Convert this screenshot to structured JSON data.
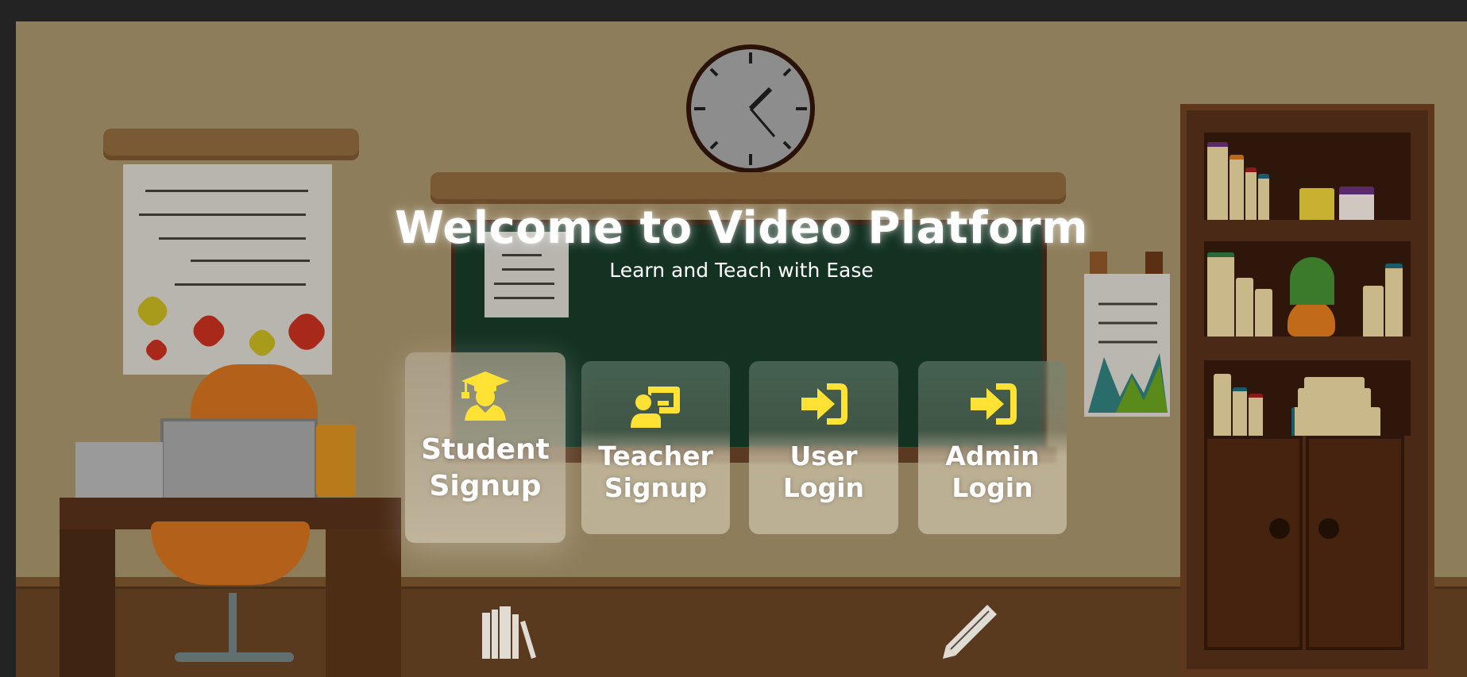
{
  "hero": {
    "title": "Welcome to Video Platform",
    "subtitle": "Learn and Teach with Ease"
  },
  "actions": [
    {
      "label": "Student\nSignup",
      "icon": "graduate-icon"
    },
    {
      "label": "Teacher\nSignup",
      "icon": "teacher-board-icon"
    },
    {
      "label": "User\nLogin",
      "icon": "sign-in-icon"
    },
    {
      "label": "Admin\nLogin",
      "icon": "sign-in-icon"
    }
  ],
  "colors": {
    "icon_accent": "#ffe234",
    "background_overlay": "#8e7d5a",
    "chalkboard": "#143222"
  }
}
